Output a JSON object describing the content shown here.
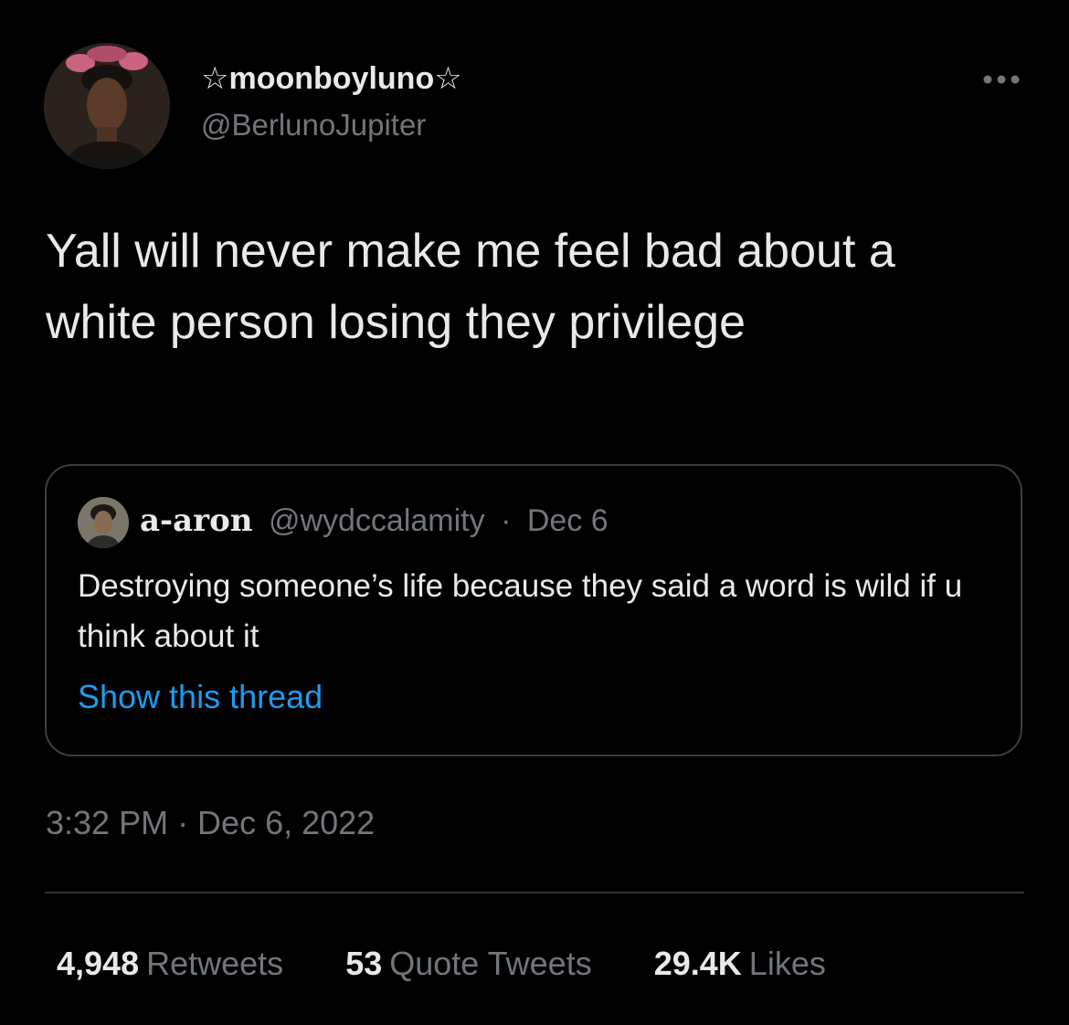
{
  "tweet": {
    "author": {
      "display_name": "☆moonboyluno☆",
      "handle": "@BerlunoJupiter"
    },
    "text": "Yall will never make me feel bad about a white person losing they privilege",
    "quoted": {
      "author_name": "a-aron",
      "author_handle": "@wydccalamity",
      "separator": "·",
      "date": "Dec 6",
      "text": "Destroying someone’s life because they said a word is wild if u think about it",
      "show_thread_label": "Show this thread"
    },
    "timestamp": "3:32 PM · Dec 6, 2022",
    "stats": {
      "retweets_count": "4,948",
      "retweets_label": "Retweets",
      "quote_tweets_count": "53",
      "quote_tweets_label": "Quote Tweets",
      "likes_count": "29.4K",
      "likes_label": "Likes"
    }
  },
  "icons": {
    "more": "more-horizontal-icon"
  },
  "colors": {
    "background": "#000000",
    "primary_text": "#e7e9ea",
    "secondary_text": "#71767b",
    "link": "#1d9bf0",
    "border": "#3a3d41"
  }
}
